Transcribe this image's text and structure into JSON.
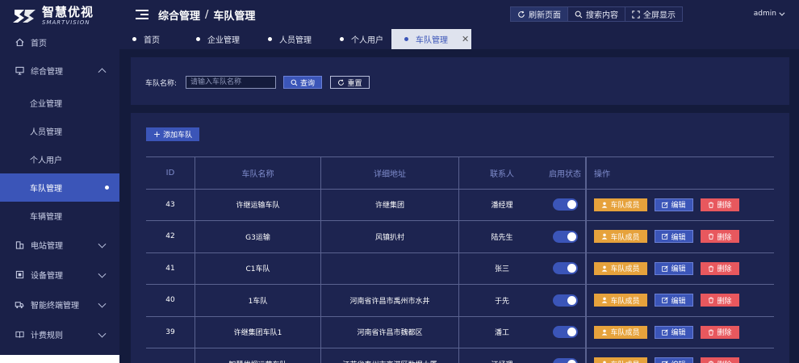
{
  "logo": {
    "cn": "智慧优视",
    "en": "SMARTVISION"
  },
  "sidebar": {
    "items": [
      {
        "label": "首页",
        "icon": "home-icon"
      },
      {
        "label": "综合管理",
        "icon": "monitor-icon",
        "expanded": true,
        "children": [
          {
            "label": "企业管理"
          },
          {
            "label": "人员管理"
          },
          {
            "label": "个人用户"
          },
          {
            "label": "车队管理",
            "active": true
          },
          {
            "label": "车辆管理"
          }
        ]
      },
      {
        "label": "电站管理",
        "icon": "building-icon"
      },
      {
        "label": "设备管理",
        "icon": "device-icon"
      },
      {
        "label": "智能终端管理",
        "icon": "truck-icon"
      },
      {
        "label": "计费规则",
        "icon": "book-icon"
      }
    ]
  },
  "header": {
    "breadcrumb": [
      "综合管理",
      "车队管理"
    ],
    "separator": "/",
    "actions": {
      "refresh": "刷新页面",
      "search": "搜索内容",
      "fullscreen": "全屏显示"
    },
    "user": "admin"
  },
  "tabs": [
    {
      "label": "首页"
    },
    {
      "label": "企业管理"
    },
    {
      "label": "人员管理"
    },
    {
      "label": "个人用户"
    },
    {
      "label": "车队管理",
      "active": true
    }
  ],
  "search": {
    "label": "车队名称:",
    "placeholder": "请输入车队名称",
    "value": "",
    "query_label": "查询",
    "reset_label": "重置"
  },
  "table": {
    "add_label": "添加车队",
    "columns": [
      "ID",
      "车队名称",
      "详细地址",
      "联系人",
      "启用状态",
      "操作"
    ],
    "actions": {
      "members": "车队成员",
      "edit": "编辑",
      "delete": "删除"
    },
    "rows": [
      {
        "id": "43",
        "name": "许继运输车队",
        "address": "许继集团",
        "contact": "潘经理",
        "enabled": true
      },
      {
        "id": "42",
        "name": "G3运输",
        "address": "风镇扒村",
        "contact": "陆先生",
        "enabled": true
      },
      {
        "id": "41",
        "name": "C1车队",
        "address": "",
        "contact": "张三",
        "enabled": true
      },
      {
        "id": "40",
        "name": "1车队",
        "address": "河南省许昌市禹州市水井",
        "contact": "于先",
        "enabled": true
      },
      {
        "id": "39",
        "name": "许继集团车队1",
        "address": "河南省许昌市魏都区",
        "contact": "潘工",
        "enabled": true
      },
      {
        "id": "",
        "name": "智慧优视运营车队",
        "address": "江苏省泰州市高港区数据大厦",
        "contact": "汪经理",
        "enabled": true
      }
    ]
  },
  "colors": {
    "accent": "#3b55b8",
    "warning": "#e6a23c",
    "danger": "#e8585e",
    "bg": "#141b3c",
    "panel": "#1d2450"
  }
}
